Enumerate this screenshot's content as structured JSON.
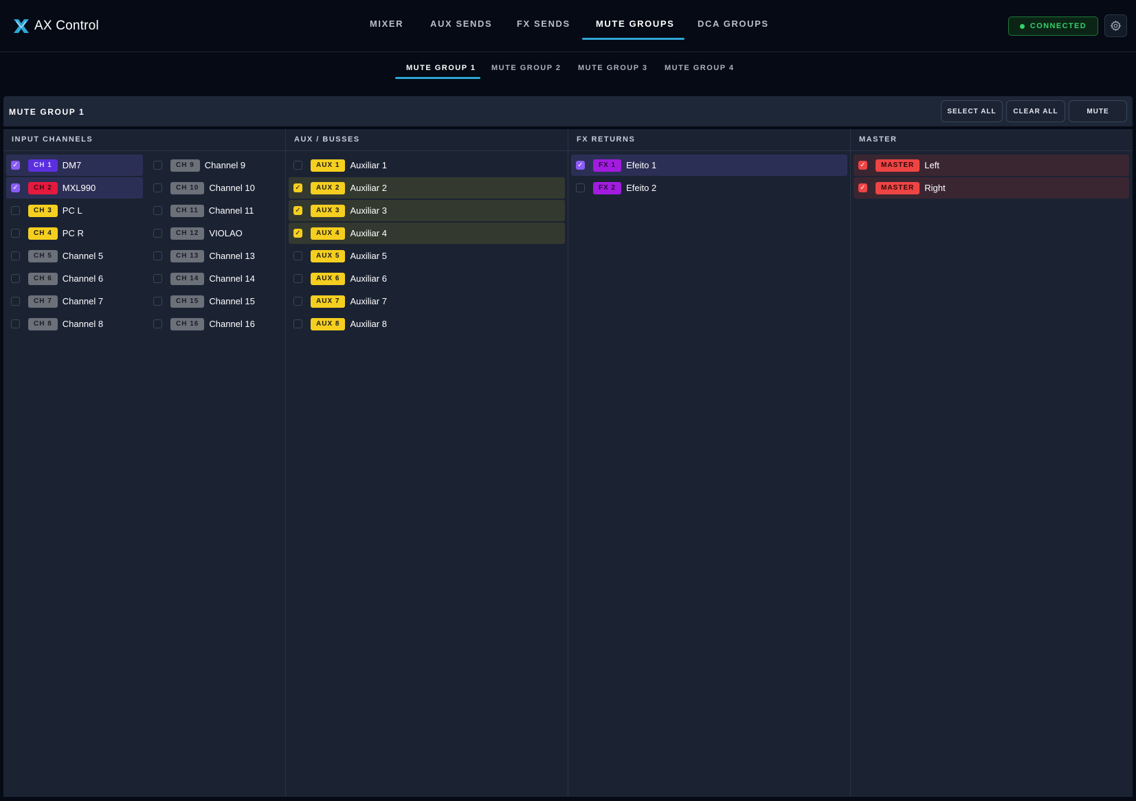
{
  "app": {
    "title": "AX Control"
  },
  "nav": {
    "tabs": [
      {
        "label": "MIXER",
        "active": false
      },
      {
        "label": "AUX SENDS",
        "active": false
      },
      {
        "label": "FX SENDS",
        "active": false
      },
      {
        "label": "MUTE GROUPS",
        "active": true
      },
      {
        "label": "DCA GROUPS",
        "active": false
      }
    ]
  },
  "status": {
    "label": "CONNECTED",
    "color": "#34d06a"
  },
  "settings": {
    "icon": "gear-icon"
  },
  "subtabs": [
    {
      "label": "MUTE GROUP 1",
      "active": true
    },
    {
      "label": "MUTE GROUP 2",
      "active": false
    },
    {
      "label": "MUTE GROUP 3",
      "active": false
    },
    {
      "label": "MUTE GROUP 4",
      "active": false
    }
  ],
  "group": {
    "title": "MUTE GROUP 1",
    "actions": {
      "select_all": "SELECT ALL",
      "clear_all": "CLEAR ALL",
      "mute": "MUTE"
    }
  },
  "columns": {
    "inputs": {
      "title": "INPUT CHANNELS",
      "items": [
        {
          "tag": "CH 1",
          "name": "DM7",
          "checked": true,
          "tag_bg": "#5b2fe0",
          "tag_fg": "#d9d2ff"
        },
        {
          "tag": "CH 2",
          "name": "MXL990",
          "checked": true,
          "tag_bg": "#e5193d",
          "tag_fg": "#3a0a12"
        },
        {
          "tag": "CH 3",
          "name": "PC L",
          "checked": false,
          "tag_bg": "#f5cf1f",
          "tag_fg": "#1a1a1a"
        },
        {
          "tag": "CH 4",
          "name": "PC R",
          "checked": false,
          "tag_bg": "#f5cf1f",
          "tag_fg": "#1a1a1a"
        },
        {
          "tag": "CH 5",
          "name": "Channel 5",
          "checked": false,
          "tag_bg": "#6b7079",
          "tag_fg": "#1b1e24"
        },
        {
          "tag": "CH 6",
          "name": "Channel 6",
          "checked": false,
          "tag_bg": "#6b7079",
          "tag_fg": "#1b1e24"
        },
        {
          "tag": "CH 7",
          "name": "Channel 7",
          "checked": false,
          "tag_bg": "#6b7079",
          "tag_fg": "#1b1e24"
        },
        {
          "tag": "CH 8",
          "name": "Channel 8",
          "checked": false,
          "tag_bg": "#6b7079",
          "tag_fg": "#1b1e24"
        },
        {
          "tag": "CH 9",
          "name": "Channel 9",
          "checked": false,
          "tag_bg": "#6b7079",
          "tag_fg": "#1b1e24"
        },
        {
          "tag": "CH 10",
          "name": "Channel 10",
          "checked": false,
          "tag_bg": "#6b7079",
          "tag_fg": "#1b1e24"
        },
        {
          "tag": "CH 11",
          "name": "Channel 11",
          "checked": false,
          "tag_bg": "#6b7079",
          "tag_fg": "#1b1e24"
        },
        {
          "tag": "CH 12",
          "name": "VIOLAO",
          "checked": false,
          "tag_bg": "#6b7079",
          "tag_fg": "#1b1e24"
        },
        {
          "tag": "CH 13",
          "name": "Channel 13",
          "checked": false,
          "tag_bg": "#6b7079",
          "tag_fg": "#1b1e24"
        },
        {
          "tag": "CH 14",
          "name": "Channel 14",
          "checked": false,
          "tag_bg": "#6b7079",
          "tag_fg": "#1b1e24"
        },
        {
          "tag": "CH 15",
          "name": "Channel 15",
          "checked": false,
          "tag_bg": "#6b7079",
          "tag_fg": "#1b1e24"
        },
        {
          "tag": "CH 16",
          "name": "Channel 16",
          "checked": false,
          "tag_bg": "#6b7079",
          "tag_fg": "#1b1e24"
        }
      ]
    },
    "aux": {
      "title": "AUX / BUSSES",
      "items": [
        {
          "tag": "AUX 1",
          "name": "Auxiliar 1",
          "checked": false
        },
        {
          "tag": "AUX 2",
          "name": "Auxiliar 2",
          "checked": true
        },
        {
          "tag": "AUX 3",
          "name": "Auxiliar 3",
          "checked": true
        },
        {
          "tag": "AUX 4",
          "name": "Auxiliar 4",
          "checked": true
        },
        {
          "tag": "AUX 5",
          "name": "Auxiliar 5",
          "checked": false
        },
        {
          "tag": "AUX 6",
          "name": "Auxiliar 6",
          "checked": false
        },
        {
          "tag": "AUX 7",
          "name": "Auxiliar 7",
          "checked": false
        },
        {
          "tag": "AUX 8",
          "name": "Auxiliar 8",
          "checked": false
        }
      ]
    },
    "fx": {
      "title": "FX RETURNS",
      "items": [
        {
          "tag": "FX 1",
          "name": "Efeito 1",
          "checked": true
        },
        {
          "tag": "FX 2",
          "name": "Efeito 2",
          "checked": false
        }
      ]
    },
    "master": {
      "title": "MASTER",
      "items": [
        {
          "tag": "MASTER",
          "name": "Left",
          "checked": true
        },
        {
          "tag": "MASTER",
          "name": "Right",
          "checked": true
        }
      ]
    }
  },
  "colors": {
    "accent": "#2fa6d6",
    "aux_tag": "#f5cf1f",
    "fx_tag": "#a21ce0",
    "master_tag": "#ef4444"
  }
}
